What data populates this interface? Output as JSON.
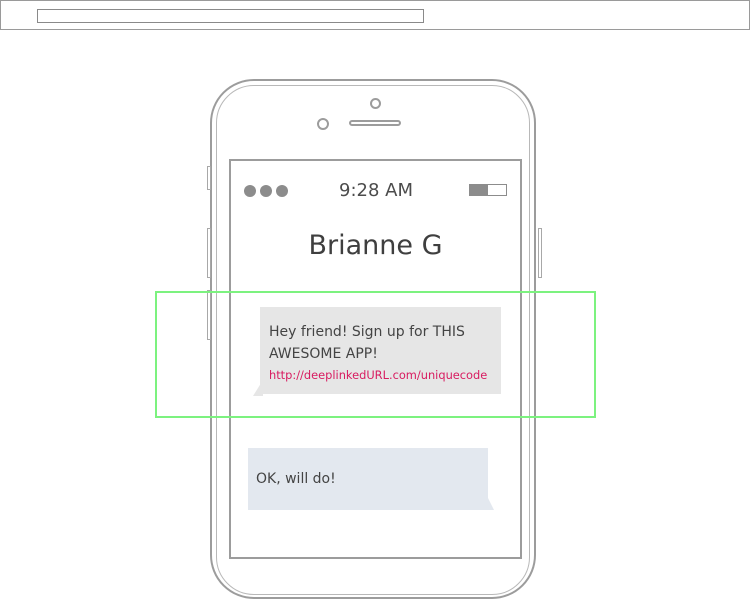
{
  "browser": {
    "url": ""
  },
  "status_bar": {
    "signal_icon": "signal-dots-icon",
    "time": "9:28 AM",
    "battery_icon": "battery-icon",
    "battery_level": 0.5
  },
  "conversation": {
    "contact_name": "Brianne G",
    "messages": [
      {
        "direction": "incoming",
        "text": "Hey friend! Sign up for THIS AWESOME APP!",
        "text_lines": [
          "Hey friend! Sign up for THIS",
          "AWESOME APP!"
        ],
        "link": "http://deeplinkedURL.com/uniquecode"
      },
      {
        "direction": "outgoing",
        "text": "OK, will do!"
      }
    ]
  },
  "colors": {
    "highlight": "#7cf27f",
    "link": "#d81b60",
    "incoming_bubble": "#e6e6e6",
    "outgoing_bubble": "#e3e8ef"
  }
}
